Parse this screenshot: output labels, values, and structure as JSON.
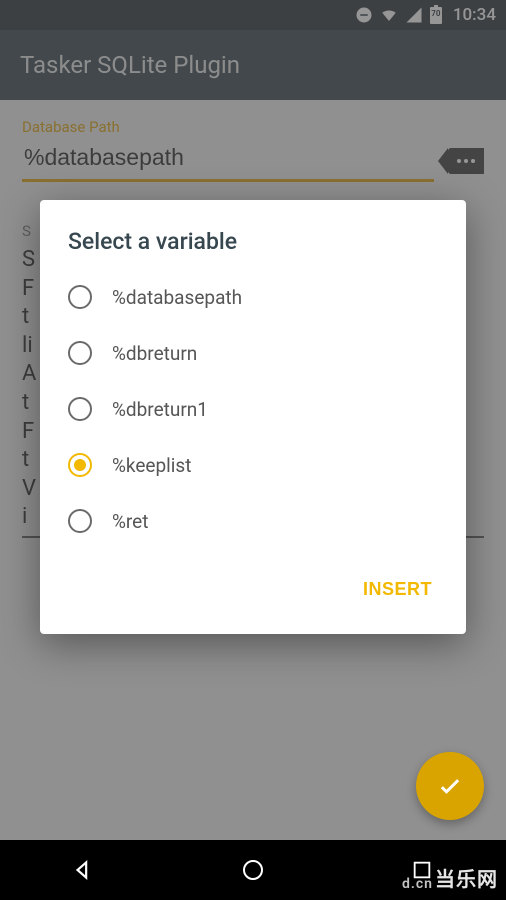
{
  "status": {
    "time": "10:34",
    "battery": "70"
  },
  "appbar": {
    "title": "Tasker SQLite Plugin"
  },
  "field": {
    "label": "Database Path",
    "value": "%databasepath"
  },
  "bg": {
    "label": "S",
    "lines": [
      "S",
      "F",
      "t",
      "li",
      "A",
      "t",
      "F",
      "t",
      "V",
      "i"
    ]
  },
  "dialog": {
    "title": "Select a variable",
    "options": [
      {
        "value": "%databasepath",
        "selected": false
      },
      {
        "value": "%dbreturn",
        "selected": false
      },
      {
        "value": "%dbreturn1",
        "selected": false
      },
      {
        "value": "%keeplist",
        "selected": true
      },
      {
        "value": "%ret",
        "selected": false
      }
    ],
    "action": "INSERT"
  },
  "watermark": "当乐网"
}
